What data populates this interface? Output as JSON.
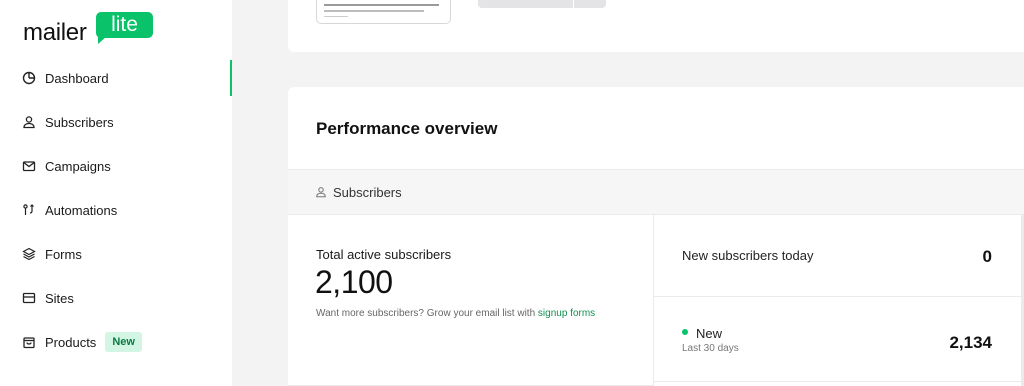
{
  "brand": {
    "word": "mailer",
    "badge": "lite",
    "accent": "#09c269"
  },
  "sidebar": {
    "items": [
      {
        "label": "Dashboard",
        "icon": "dashboard-icon",
        "active": true
      },
      {
        "label": "Subscribers",
        "icon": "user-icon"
      },
      {
        "label": "Campaigns",
        "icon": "mail-icon"
      },
      {
        "label": "Automations",
        "icon": "automation-icon"
      },
      {
        "label": "Forms",
        "icon": "layers-icon"
      },
      {
        "label": "Sites",
        "icon": "browser-icon"
      },
      {
        "label": "Products",
        "icon": "bag-icon",
        "badge": "New"
      }
    ]
  },
  "performance": {
    "title": "Performance overview",
    "tab": "Subscribers",
    "total_label": "Total active subscribers",
    "total_value": "2,100",
    "hint_text": "Want more subscribers? Grow your email list with ",
    "hint_link": "signup forms",
    "today_label": "New subscribers today",
    "today_value": "0",
    "new_label": "New",
    "new_sub": "Last 30 days",
    "new_value": "2,134"
  }
}
